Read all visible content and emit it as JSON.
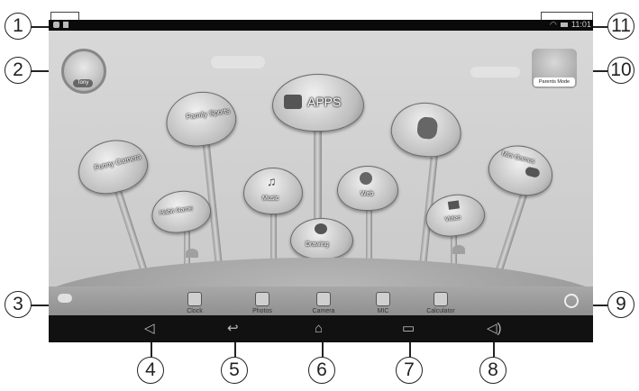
{
  "callouts": [
    "1",
    "2",
    "3",
    "4",
    "5",
    "6",
    "7",
    "8",
    "9",
    "10",
    "11"
  ],
  "status": {
    "time": "11:01"
  },
  "profile": {
    "name": "Tony"
  },
  "parents": {
    "label": "Parents Mode"
  },
  "apps_main": {
    "label": "APPS"
  },
  "bubbles": {
    "family_sports": "Family Sports",
    "funny_camera": "Funny Camera",
    "habit_game": "Habit Game",
    "music": "Music",
    "web": "Web",
    "video": "Video",
    "mini_games": "Mini Games",
    "drawing": "Drawing"
  },
  "dock": {
    "clock": "Clock",
    "photos": "Photos",
    "camera": "Camera",
    "mic": "MIC",
    "calculator": "Calculator"
  }
}
